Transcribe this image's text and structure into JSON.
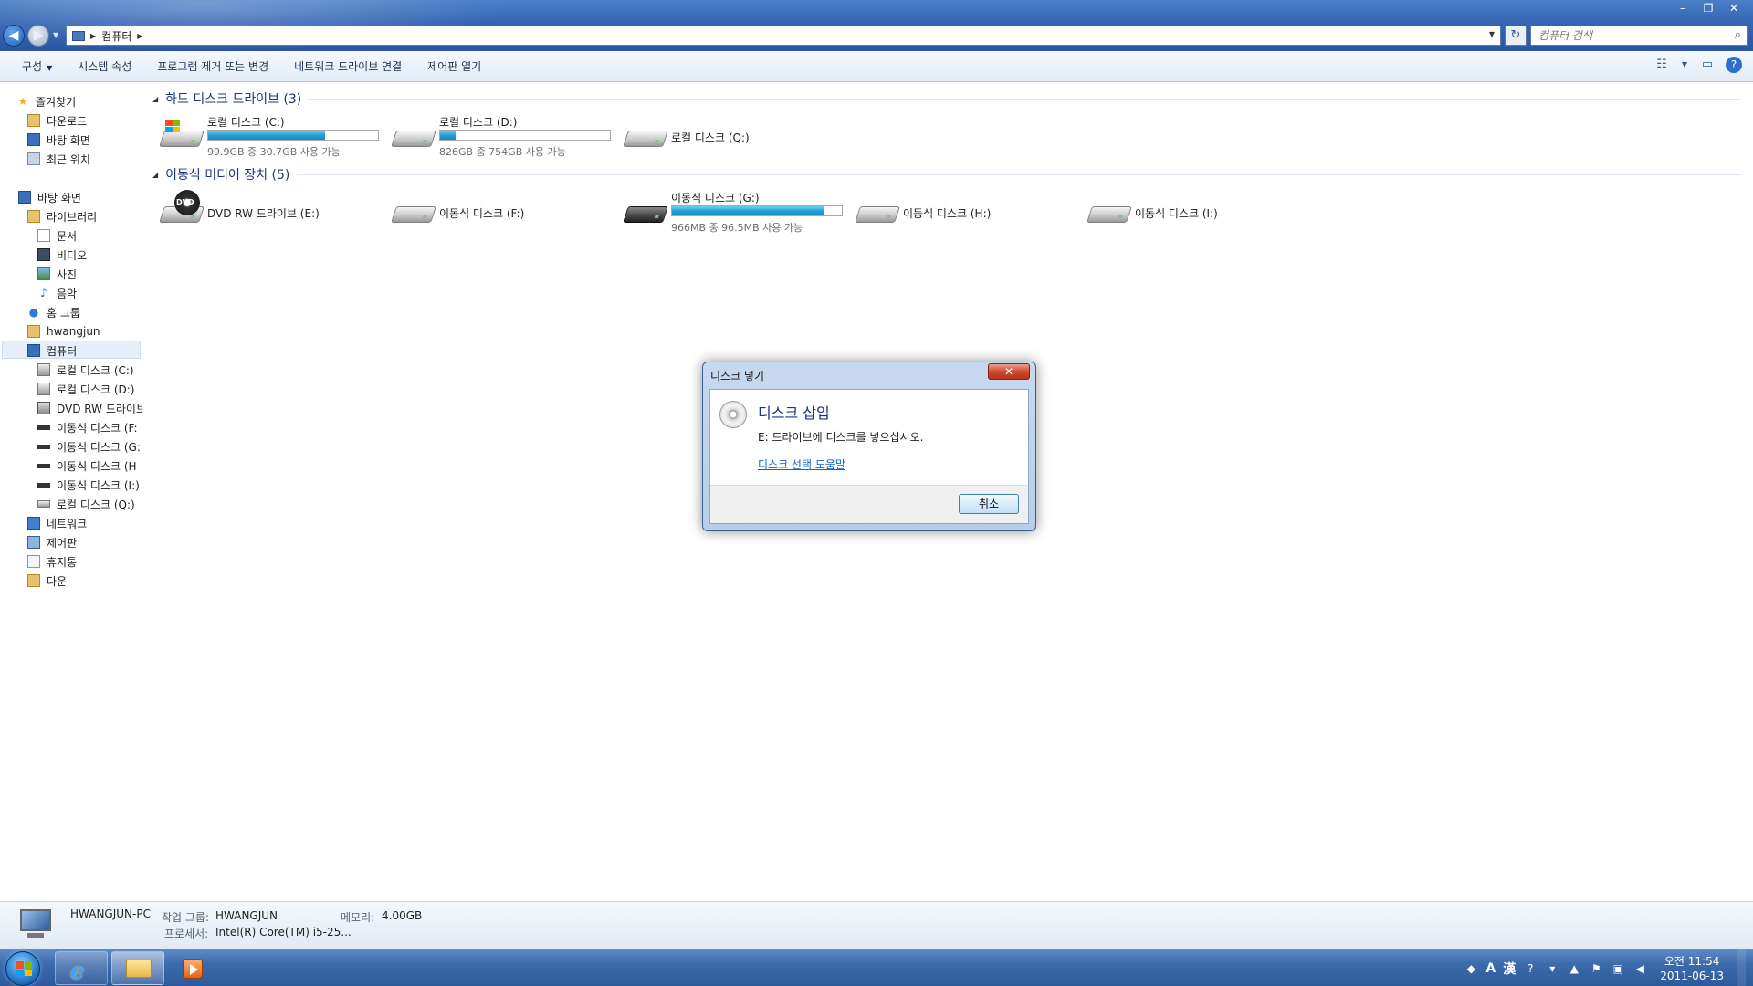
{
  "window": {
    "address_crumb": "컴퓨터",
    "search_placeholder": "컴퓨터 검색",
    "minimize": "–",
    "maximize": "❐",
    "close": "✕"
  },
  "toolbar": {
    "organize": "구성",
    "system_properties": "시스템 속성",
    "uninstall": "프로그램 제거 또는 변경",
    "map_drive": "네트워크 드라이브 연결",
    "control_panel": "제어판 열기"
  },
  "sidebar": {
    "favorites": "즐겨찾기",
    "downloads": "다운로드",
    "desktop_fav": "바탕 화면",
    "recent": "최근 위치",
    "desktop": "바탕 화면",
    "libraries": "라이브러리",
    "documents": "문서",
    "videos": "비디오",
    "pictures": "사진",
    "music": "음악",
    "homegroup": "홈 그룹",
    "user": "hwangjun",
    "computer": "컴퓨터",
    "drive_c": "로컬 디스크 (C:)",
    "drive_d": "로컬 디스크 (D:)",
    "drive_e": "DVD RW 드라이브",
    "drive_f": "이동식 디스크 (F:",
    "drive_g": "이동식 디스크 (G:",
    "drive_h": "이동식 디스크 (H",
    "drive_i": "이동식 디스크 (I:)",
    "drive_q": "로컬 디스크 (Q:)",
    "network": "네트워크",
    "control_panel": "제어판",
    "recycle_bin": "휴지통",
    "other": "다운"
  },
  "groups": {
    "hdd": "하드 디스크 드라이브 (3)",
    "removable": "이동식 미디어 장치 (5)"
  },
  "drives": {
    "c": {
      "name": "로컬 디스크 (C:)",
      "info": "99.9GB 중 30.7GB 사용 가능",
      "used_fraction": 0.69
    },
    "d": {
      "name": "로컬 디스크 (D:)",
      "info": "826GB 중 754GB 사용 가능",
      "used_fraction": 0.09
    },
    "q": {
      "name": "로컬 디스크 (Q:)"
    },
    "e": {
      "name": "DVD RW 드라이브 (E:)",
      "dvd_label": "DVD"
    },
    "f": {
      "name": "이동식 디스크 (F:)"
    },
    "g": {
      "name": "이동식 디스크 (G:)",
      "info": "966MB 중 96.5MB 사용 가능",
      "used_fraction": 0.9
    },
    "h": {
      "name": "이동식 디스크 (H:)"
    },
    "i": {
      "name": "이동식 디스크 (I:)"
    }
  },
  "dialog": {
    "title": "디스크 넣기",
    "heading": "디스크 삽입",
    "message": "E: 드라이브에 디스크를 넣으십시오.",
    "link": "디스크 선택 도움말",
    "cancel": "취소"
  },
  "details": {
    "pc_name": "HWANGJUN-PC",
    "workgroup_label": "작업 그룹:",
    "workgroup_value": "HWANGJUN",
    "memory_label": "메모리:",
    "memory_value": "4.00GB",
    "processor_label": "프로세서:",
    "processor_value": "Intel(R) Core(TM) i5-25..."
  },
  "taskbar": {
    "ie_glyph": "e",
    "ime_a": "A",
    "ime_han": "漢",
    "time": "오전 11:54",
    "date": "2011-06-13"
  }
}
